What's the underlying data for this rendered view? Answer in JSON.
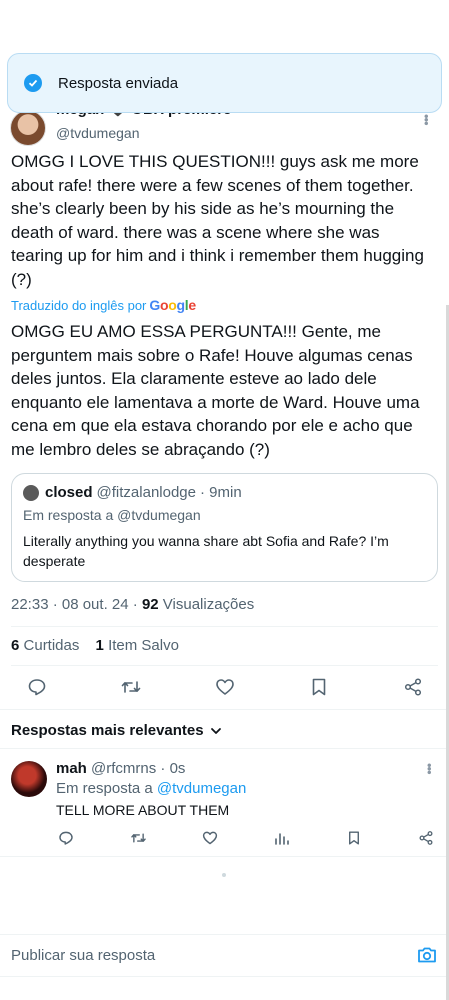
{
  "toast": {
    "message": "Resposta enviada"
  },
  "author": {
    "name": "megan 🖤 OBX premiere",
    "handle": "@tvdumegan"
  },
  "tweet": {
    "original": "OMGG I LOVE THIS QUESTION!!! guys ask me more about rafe! there were a few scenes of them together. she’s clearly been by his side as he’s mourning the death of ward. there was a scene where she was tearing up for him and i think i remember them hugging (?)",
    "translated_label": "Traduzido do inglês por",
    "translated_by": "Google",
    "translation": "OMGG EU AMO ESSA PERGUNTA!!! Gente, me perguntem mais sobre o Rafe! Houve algumas cenas deles juntos. Ela claramente esteve ao lado dele enquanto ele lamentava a morte de Ward. Houve uma cena em que ela estava chorando por ele e acho que me lembro deles se abraçando (?)"
  },
  "quote": {
    "name": "closed",
    "handle": "@fitzalanlodge",
    "time": "· 9min",
    "reply_to": "Em resposta a @tvdumegan",
    "text": "Literally anything you wanna share abt Sofia and Rafe? I’m desperate"
  },
  "meta": {
    "time": "22:33 · 08 out. 24 ·",
    "views_count": "92",
    "views_label": "Visualizações"
  },
  "stats": {
    "likes_count": "6",
    "likes_label": "Curtidas",
    "saves_count": "1",
    "saves_label": "Item Salvo"
  },
  "sort": {
    "label": "Respostas mais relevantes"
  },
  "reply": {
    "name": "mah",
    "handle": "@rfcmrns · 0s",
    "reply_to_prefix": "Em resposta a",
    "reply_to_handle": "@tvdumegan",
    "text": "TELL MORE ABOUT THEM"
  },
  "compose": {
    "placeholder": "Publicar sua resposta"
  },
  "colors": {
    "accent": "#1d9bf0",
    "text": "#0f1419",
    "muted": "#536471"
  },
  "icons": [
    "check-icon",
    "more-icon",
    "reply-icon",
    "retweet-icon",
    "like-icon",
    "bookmark-icon",
    "share-icon",
    "chevron-down-icon",
    "views-icon",
    "camera-icon"
  ]
}
